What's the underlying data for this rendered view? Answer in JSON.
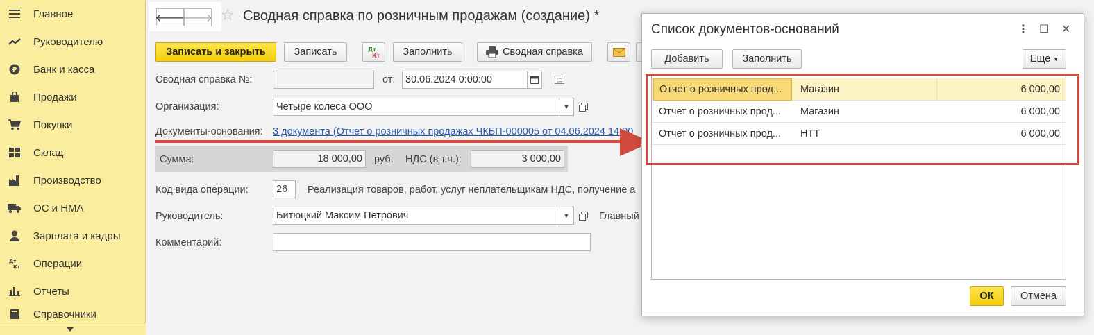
{
  "sidebar": {
    "items": [
      {
        "label": "Главное",
        "icon": "menu-lines-icon"
      },
      {
        "label": "Руководителю",
        "icon": "trend-icon"
      },
      {
        "label": "Банк и касса",
        "icon": "ruble-coin-icon"
      },
      {
        "label": "Продажи",
        "icon": "shopping-bag-icon"
      },
      {
        "label": "Покупки",
        "icon": "cart-icon"
      },
      {
        "label": "Склад",
        "icon": "warehouse-icon"
      },
      {
        "label": "Производство",
        "icon": "factory-icon"
      },
      {
        "label": "ОС и НМА",
        "icon": "truck-icon"
      },
      {
        "label": "Зарплата и кадры",
        "icon": "person-icon"
      },
      {
        "label": "Операции",
        "icon": "dt-kt-icon"
      },
      {
        "label": "Отчеты",
        "icon": "bar-chart-icon"
      },
      {
        "label": "Справочники",
        "icon": "book-icon"
      }
    ]
  },
  "form": {
    "title": "Сводная справка по розничным продажам (создание) *",
    "toolbar": {
      "save_close": "Записать и закрыть",
      "save": "Записать",
      "dtkt": "Дт Кт",
      "fill": "Заполнить",
      "print": "Сводная справка"
    },
    "fields": {
      "number_label": "Сводная справка №:",
      "number_value": "",
      "date_label": "от:",
      "date_value": "30.06.2024  0:00:00",
      "org_label": "Организация:",
      "org_value": "Четыре колеса ООО",
      "docs_label": "Документы-основания:",
      "docs_link": "3 документа (Отчет о розничных продажах ЧКБП-000005 от 04.06.2024 14:00",
      "sum_label": "Сумма:",
      "sum_value": "18 000,00",
      "currency": "руб.",
      "vat_label": "НДС (в т.ч.):",
      "vat_value": "3 000,00",
      "opcode_label": "Код вида операции:",
      "opcode_value": "26",
      "opcode_desc": "Реализация товаров, работ, услуг неплательщикам НДС, получение а",
      "head_label": "Руководитель:",
      "head_value": "Битюцкий Максим Петрович",
      "chief_label": "Главный",
      "comment_label": "Комментарий:",
      "comment_value": ""
    }
  },
  "dialog": {
    "title": "Список документов-оснований",
    "add": "Добавить",
    "fill": "Заполнить",
    "more": "Еще",
    "ok": "ОК",
    "cancel": "Отмена",
    "rows": [
      {
        "doc": "Отчет о розничных прод...",
        "store": "Магазин",
        "amount": "6 000,00"
      },
      {
        "doc": "Отчет о розничных прод...",
        "store": "Магазин",
        "amount": "6 000,00"
      },
      {
        "doc": "Отчет о розничных прод...",
        "store": "НТТ",
        "amount": "6 000,00"
      }
    ]
  },
  "colors": {
    "sidebar_bg": "#fbed9e",
    "primary_button": "#f2cd0c",
    "highlight_red": "#d24b3e",
    "link": "#2a5db0"
  }
}
